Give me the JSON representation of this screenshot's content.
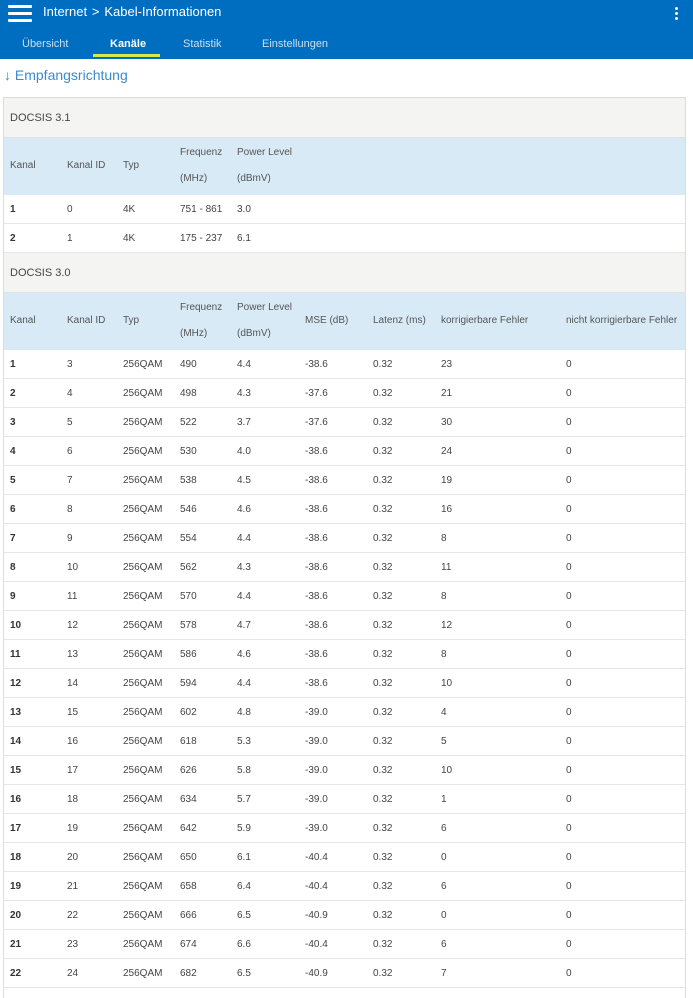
{
  "header": {
    "section": "Internet",
    "separator": ">",
    "page": "Kabel-Informationen"
  },
  "icons": {
    "menu": "hamburger-menu-icon",
    "more": "vertical-dots-icon",
    "direction": "arrow-down-icon"
  },
  "colors": {
    "appbar": "#006ec0",
    "tab_indicator": "#d6e84a",
    "table_header": "#d9eaf7",
    "link": "#3a8bd0"
  },
  "tabs": [
    {
      "label": "Übersicht"
    },
    {
      "label": "Kanäle"
    },
    {
      "label": "Statistik"
    },
    {
      "label": "Einstellungen"
    }
  ],
  "active_tab": "Kanäle",
  "section_title": "↓ Empfangsrichtung",
  "docsis31": {
    "title": "DOCSIS 3.1",
    "columns": [
      {
        "l1": "Kanal",
        "l2": ""
      },
      {
        "l1": "Kanal ID",
        "l2": ""
      },
      {
        "l1": "Typ",
        "l2": ""
      },
      {
        "l1": "Frequenz",
        "l2": "(MHz)"
      },
      {
        "l1": "Power Level",
        "l2": "(dBmV)"
      }
    ],
    "rows": [
      [
        "1",
        "0",
        "4K",
        "751 - 861",
        "3.0"
      ],
      [
        "2",
        "1",
        "4K",
        "175 - 237",
        "6.1"
      ]
    ]
  },
  "docsis30": {
    "title": "DOCSIS 3.0",
    "columns": [
      {
        "l1": "Kanal",
        "l2": ""
      },
      {
        "l1": "Kanal ID",
        "l2": ""
      },
      {
        "l1": "Typ",
        "l2": ""
      },
      {
        "l1": "Frequenz",
        "l2": "(MHz)"
      },
      {
        "l1": "Power Level",
        "l2": "(dBmV)"
      },
      {
        "l1": "MSE (dB)",
        "l2": ""
      },
      {
        "l1": "Latenz (ms)",
        "l2": ""
      },
      {
        "l1": "korrigierbare Fehler",
        "l2": ""
      },
      {
        "l1": "nicht korrigierbare Fehler",
        "l2": ""
      }
    ],
    "rows": [
      [
        "1",
        "3",
        "256QAM",
        "490",
        "4.4",
        "-38.6",
        "0.32",
        "23",
        "0"
      ],
      [
        "2",
        "4",
        "256QAM",
        "498",
        "4.3",
        "-37.6",
        "0.32",
        "21",
        "0"
      ],
      [
        "3",
        "5",
        "256QAM",
        "522",
        "3.7",
        "-37.6",
        "0.32",
        "30",
        "0"
      ],
      [
        "4",
        "6",
        "256QAM",
        "530",
        "4.0",
        "-38.6",
        "0.32",
        "24",
        "0"
      ],
      [
        "5",
        "7",
        "256QAM",
        "538",
        "4.5",
        "-38.6",
        "0.32",
        "19",
        "0"
      ],
      [
        "6",
        "8",
        "256QAM",
        "546",
        "4.6",
        "-38.6",
        "0.32",
        "16",
        "0"
      ],
      [
        "7",
        "9",
        "256QAM",
        "554",
        "4.4",
        "-38.6",
        "0.32",
        "8",
        "0"
      ],
      [
        "8",
        "10",
        "256QAM",
        "562",
        "4.3",
        "-38.6",
        "0.32",
        "11",
        "0"
      ],
      [
        "9",
        "11",
        "256QAM",
        "570",
        "4.4",
        "-38.6",
        "0.32",
        "8",
        "0"
      ],
      [
        "10",
        "12",
        "256QAM",
        "578",
        "4.7",
        "-38.6",
        "0.32",
        "12",
        "0"
      ],
      [
        "11",
        "13",
        "256QAM",
        "586",
        "4.6",
        "-38.6",
        "0.32",
        "8",
        "0"
      ],
      [
        "12",
        "14",
        "256QAM",
        "594",
        "4.4",
        "-38.6",
        "0.32",
        "10",
        "0"
      ],
      [
        "13",
        "15",
        "256QAM",
        "602",
        "4.8",
        "-39.0",
        "0.32",
        "4",
        "0"
      ],
      [
        "14",
        "16",
        "256QAM",
        "618",
        "5.3",
        "-39.0",
        "0.32",
        "5",
        "0"
      ],
      [
        "15",
        "17",
        "256QAM",
        "626",
        "5.8",
        "-39.0",
        "0.32",
        "10",
        "0"
      ],
      [
        "16",
        "18",
        "256QAM",
        "634",
        "5.7",
        "-39.0",
        "0.32",
        "1",
        "0"
      ],
      [
        "17",
        "19",
        "256QAM",
        "642",
        "5.9",
        "-39.0",
        "0.32",
        "6",
        "0"
      ],
      [
        "18",
        "20",
        "256QAM",
        "650",
        "6.1",
        "-40.4",
        "0.32",
        "0",
        "0"
      ],
      [
        "19",
        "21",
        "256QAM",
        "658",
        "6.4",
        "-40.4",
        "0.32",
        "6",
        "0"
      ],
      [
        "20",
        "22",
        "256QAM",
        "666",
        "6.5",
        "-40.9",
        "0.32",
        "0",
        "0"
      ],
      [
        "21",
        "23",
        "256QAM",
        "674",
        "6.6",
        "-40.4",
        "0.32",
        "6",
        "0"
      ],
      [
        "22",
        "24",
        "256QAM",
        "682",
        "6.5",
        "-40.9",
        "0.32",
        "7",
        "0"
      ]
    ]
  }
}
